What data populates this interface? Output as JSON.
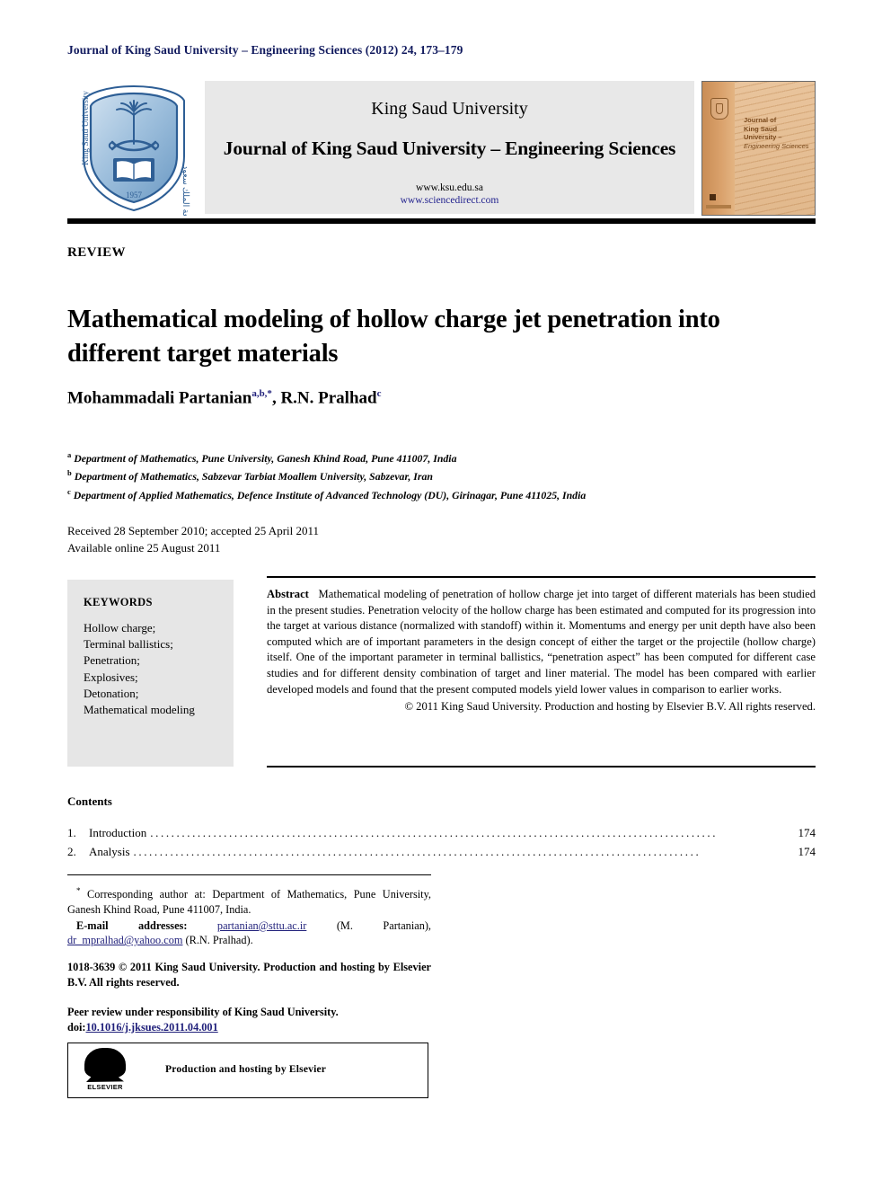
{
  "running_head": "Journal of King Saud University – Engineering Sciences (2012) 24, 173–179",
  "masthead": {
    "logo_alt": "king-saud-university-shield",
    "university": "King Saud University",
    "journal": "Journal of King Saud University – Engineering Sciences",
    "url_primary": "www.ksu.edu.sa",
    "url_secondary": "www.sciencedirect.com",
    "cover": {
      "line1": "Journal of",
      "line2": "King Saud University –",
      "line3": "Engineering Sciences"
    }
  },
  "article": {
    "type_label": "REVIEW",
    "title": "Mathematical modeling of hollow charge jet penetration into different target materials",
    "authors": [
      {
        "name": "Mohammadali Partanian",
        "sup": "a,b,*"
      },
      {
        "name": "R.N. Pralhad",
        "sup": "c"
      }
    ],
    "affiliations": [
      {
        "marker": "a",
        "text": "Department of Mathematics, Pune University, Ganesh Khind Road, Pune 411007, India"
      },
      {
        "marker": "b",
        "text": "Department of Mathematics, Sabzevar Tarbiat Moallem University, Sabzevar, Iran"
      },
      {
        "marker": "c",
        "text": "Department of Applied Mathematics, Defence Institute of Advanced Technology (DU), Girinagar, Pune 411025, India"
      }
    ],
    "received_line": "Received 28 September 2010; accepted 25 April 2011",
    "available_line": "Available online 25 August 2011"
  },
  "keywords": {
    "heading": "KEYWORDS",
    "items": [
      "Hollow charge;",
      "Terminal ballistics;",
      "Penetration;",
      "Explosives;",
      "Detonation;",
      "Mathematical modeling"
    ]
  },
  "abstract": {
    "label": "Abstract",
    "text": "Mathematical modeling of penetration of hollow charge jet into target of different materials has been studied in the present studies. Penetration velocity of the hollow charge has been estimated and computed for its progression into the target at various distance (normalized with standoff) within it. Momentums and energy per unit depth have also been computed which are of important parameters in the design concept of either the target or the projectile (hollow charge) itself. One of the important parameter in terminal ballistics, “penetration aspect” has been computed for different case studies and for different density combination of target and liner material. The model has been compared with earlier developed models and found that the present computed models yield lower values in comparison to earlier works.",
    "copyright": "© 2011 King Saud University. Production and hosting by Elsevier B.V. All rights reserved."
  },
  "contents": {
    "heading": "Contents",
    "entries": [
      {
        "num": "1.",
        "label": "Introduction",
        "page": "174"
      },
      {
        "num": "2.",
        "label": "Analysis",
        "page": "174"
      }
    ]
  },
  "footnotes": {
    "corresponding_marker": "*",
    "corresponding": "Corresponding author at: Department of Mathematics, Pune University, Ganesh Khind Road, Pune 411007, India.",
    "emails_label": "E-mail addresses:",
    "email_1": "partanian@sttu.ac.ir",
    "email_1_owner": "(M. Partanian),",
    "email_2": "dr_mpralhad@yahoo.com",
    "email_2_owner": "(R.N. Pralhad).",
    "issn_line": "1018-3639 © 2011 King Saud University. Production and hosting by Elsevier B.V. All rights reserved.",
    "peer_review": "Peer review under responsibility of King Saud University.",
    "doi_label": "doi:",
    "doi_value": "10.1016/j.jksues.2011.04.001"
  },
  "elsevier": {
    "wordmark": "ELSEVIER",
    "caption": "Production and hosting by Elsevier"
  },
  "colors": {
    "link_blue": "#1f1f7a",
    "running_head_blue": "#111a5e",
    "masthead_grey": "#e8e8e8",
    "keywords_grey": "#e6e6e6"
  }
}
